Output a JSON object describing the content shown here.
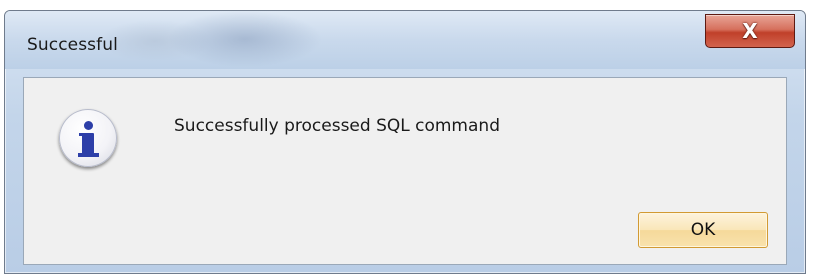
{
  "window": {
    "title": "Successful"
  },
  "title_controls": {
    "close_label": "X"
  },
  "dialog": {
    "icon": "information-icon",
    "message": "Successfully processed SQL command",
    "ok_label": "OK"
  },
  "colors": {
    "close_button": "#c7442e",
    "icon_accent": "#2d3fa8",
    "ok_button_border": "#d29a33"
  }
}
